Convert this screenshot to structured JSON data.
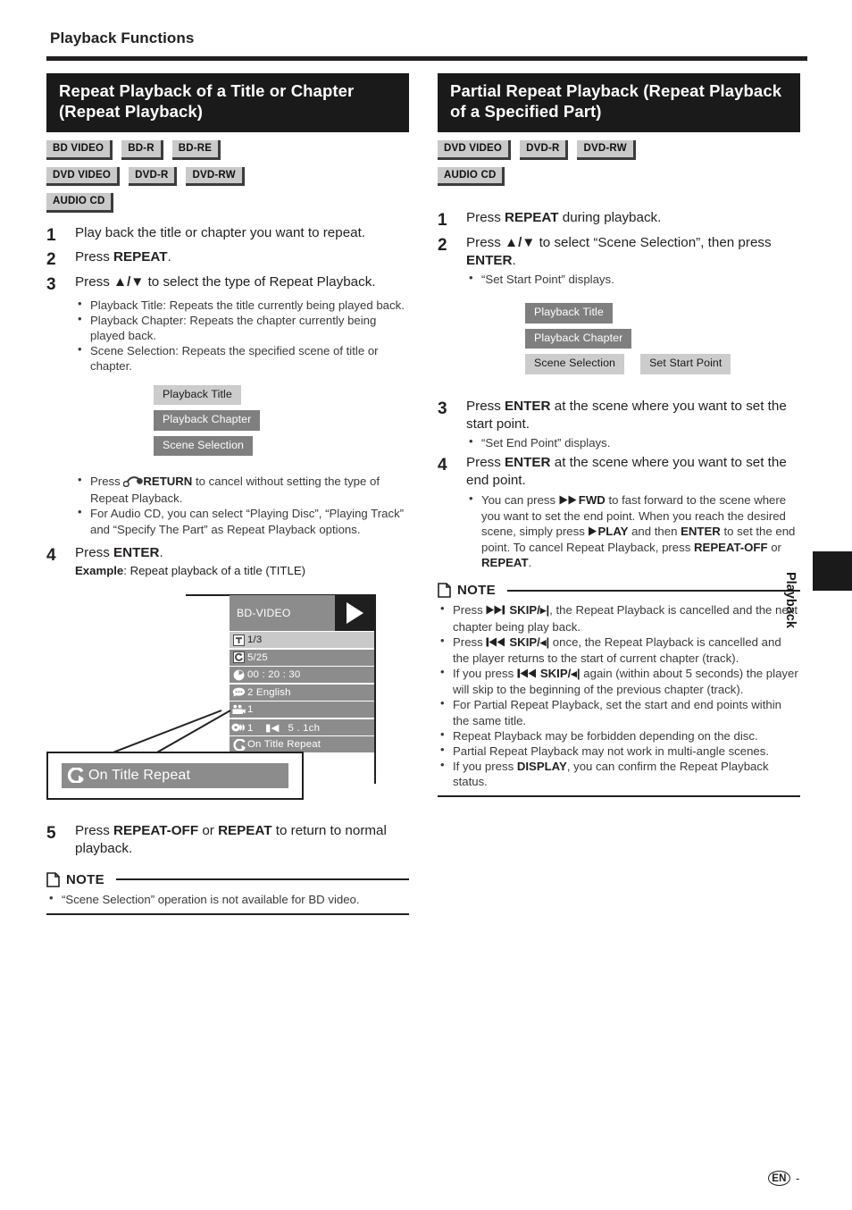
{
  "page": {
    "running_head": "Playback Functions",
    "footer_locale": "EN",
    "footer_page": "-",
    "thumb_tab_label": "Playback"
  },
  "left": {
    "banner_title": "Repeat Playback of a Title or Chapter (Repeat Playback)",
    "badges": [
      [
        "BD VIDEO",
        "BD-R",
        "BD-RE"
      ],
      [
        "DVD VIDEO",
        "DVD-R",
        "DVD-RW"
      ],
      [
        "AUDIO CD"
      ]
    ],
    "steps": [
      {
        "num": "1",
        "text": "Play back the title or chapter you want to repeat."
      },
      {
        "num": "2",
        "text_pre": "Press ",
        "bold": "REPEAT",
        "text_post": "."
      },
      {
        "num": "3",
        "text_pre": "Press ",
        "keys": "▲/▼",
        "text_post": " to select the type of Repeat Playback."
      },
      {
        "num": "4",
        "text_pre": "Press ",
        "bold": "ENTER",
        "text_post": "."
      },
      {
        "num": "5",
        "text_pre": "Press ",
        "bold": "REPEAT-OFF",
        "mid": " or ",
        "bold2": "REPEAT",
        "text_post": " to return to normal playback."
      }
    ],
    "step3_bullets": [
      "Playback Title: Repeats the title currently being played back.",
      "Playback Chapter: Repeats the chapter currently being played back.",
      "Scene Selection: Repeats the specified scene of title or chapter."
    ],
    "chips": [
      {
        "label": "Playback Title",
        "state": "selected"
      },
      {
        "label": "Playback Chapter",
        "state": "unselected"
      },
      {
        "label": "Scene Selection",
        "state": "unselected"
      }
    ],
    "after_chip_bullets": [
      {
        "pre": "Press ",
        "icon": "return-icon",
        "bold": "RETURN",
        "post": " to cancel without setting the type of Repeat Playback."
      },
      {
        "pre": "For Audio CD, you can select “Playing Disc”, “Playing Track” and “Specify The Part” as Repeat Playback options.",
        "bold": "",
        "post": ""
      }
    ],
    "example_label_bold": "Example",
    "example_label_rest": ": Repeat playback of a title (TITLE)",
    "osd": {
      "disc_type": "BD-VIDEO",
      "rows": [
        {
          "icon": "title-icon",
          "value": "1/3",
          "highlight": true
        },
        {
          "icon": "chapter-icon",
          "value": "5/25",
          "highlight": false
        },
        {
          "icon": "time-icon",
          "value": "00 : 20 : 30",
          "highlight": false
        },
        {
          "icon": "subtitle-icon",
          "value": "2 English",
          "highlight": false
        },
        {
          "icon": "angle-icon",
          "value": "1",
          "highlight": false
        },
        {
          "icon": "audio-icon",
          "value": "1    ▮◀   5 . 1ch",
          "highlight": false
        },
        {
          "icon": "repeat-icon",
          "value": "On Title Repeat",
          "highlight": false
        }
      ]
    },
    "callout_text": "On Title Repeat",
    "note": {
      "title": "NOTE",
      "items": [
        "“Scene Selection” operation is not available for BD video."
      ]
    }
  },
  "right": {
    "banner_title": "Partial Repeat Playback (Repeat Playback of a Specified Part)",
    "badges": [
      [
        "DVD VIDEO",
        "DVD-R",
        "DVD-RW"
      ],
      [
        "AUDIO CD"
      ]
    ],
    "steps": [
      {
        "num": "1",
        "text_pre": "Press ",
        "bold": "REPEAT",
        "text_post": " during playback."
      },
      {
        "num": "2",
        "text_pre": "Press ",
        "keys": "▲/▼",
        "mid": " to select “Scene Selection”, then press ",
        "bold": "ENTER",
        "text_post": "."
      },
      {
        "num": "3",
        "text_pre": "Press ",
        "bold": "ENTER",
        "text_post": " at the scene where you want to set the start point."
      },
      {
        "num": "4",
        "text_pre": "Press ",
        "bold": "ENTER",
        "text_post": " at the scene where you want to set the end point."
      }
    ],
    "step2_bullet": "“Set Start Point” displays.",
    "step3_bullet": "“Set End Point” displays.",
    "chips": [
      [
        {
          "label": "Playback Title",
          "state": "unselected"
        }
      ],
      [
        {
          "label": "Playback Chapter",
          "state": "unselected"
        }
      ],
      [
        {
          "label": "Scene Selection",
          "state": "selected"
        },
        {
          "label": "Set Start Point",
          "state": "selected"
        }
      ]
    ],
    "step4_bullet": {
      "p1": "You can press ",
      "b1": "FWD",
      "p2": " to fast forward to the scene where you want to set the end point. When you reach the desired scene, simply press ",
      "b2": "PLAY",
      "p3": " and then ",
      "b3": "ENTER",
      "p4": " to set the end point. To cancel Repeat Playback, press ",
      "b4": "REPEAT-OFF",
      "p5": " or ",
      "b5": "REPEAT",
      "p6": "."
    },
    "note": {
      "title": "NOTE",
      "items": [
        {
          "pre": "Press ",
          "icon": "skip-forward-icon",
          "bold": "SKIP/▸|",
          "post": ", the Repeat Playback is cancelled and the next chapter being play back."
        },
        {
          "pre": "Press ",
          "icon": "skip-back-icon",
          "bold": "SKIP/◂|",
          "post": " once, the Repeat Playback is cancelled and the player returns to the start of current chapter (track)."
        },
        {
          "pre": "If you press ",
          "icon": "skip-back-icon",
          "bold": "SKIP/◂|",
          "post": " again (within about 5 seconds) the player will skip to the beginning of the previous chapter (track)."
        },
        {
          "pre": "For Partial Repeat Playback, set the start and end points within the same title.",
          "bold": "",
          "post": ""
        },
        {
          "pre": "Repeat Playback may be forbidden depending on the disc.",
          "bold": "",
          "post": ""
        },
        {
          "pre": "Partial Repeat Playback may not work in multi-angle scenes.",
          "bold": "",
          "post": ""
        },
        {
          "pre": "If you press ",
          "bold": "DISPLAY",
          "post": ", you can confirm the Repeat Playback status."
        }
      ]
    }
  },
  "colors": {
    "ink": "#231f20",
    "banner_bg": "#1a1a1a",
    "badge_bg": "#c9c9c9",
    "chip_selected_bg": "#cccccc",
    "chip_unselected_bg": "#7f7f7f",
    "osd_row_bg": "#8c8c8c",
    "osd_row_highlight_bg": "#c9c9c9"
  }
}
